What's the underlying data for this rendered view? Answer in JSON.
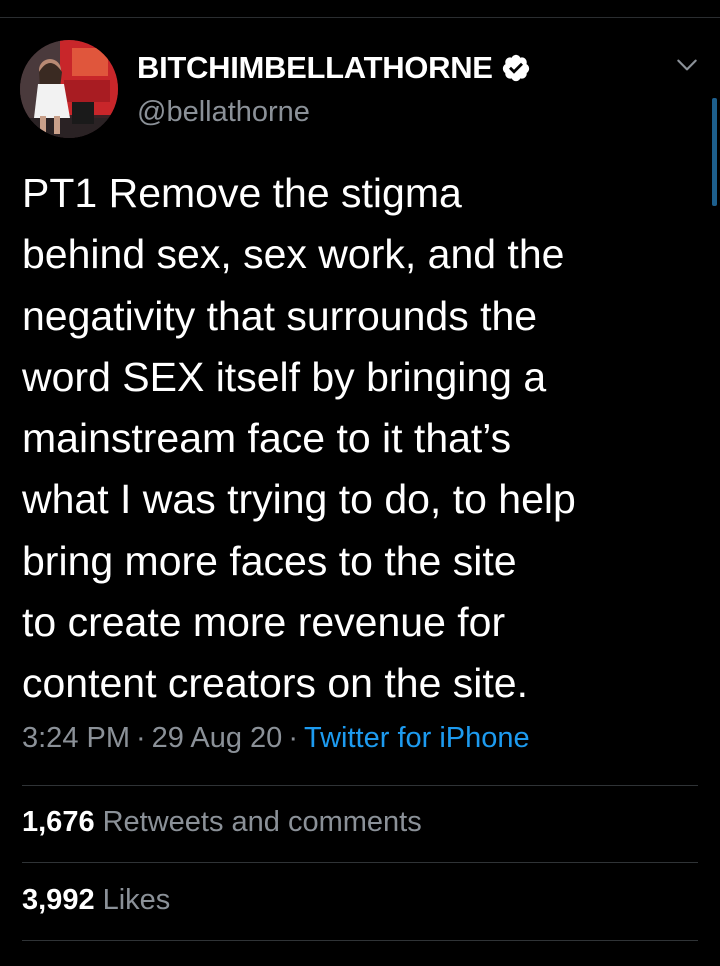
{
  "user": {
    "display_name": "BITCHIMBELLATHORNE",
    "handle": "@bellathorne",
    "verified": true
  },
  "tweet": {
    "lines": [
      "PT1 Remove the stigma",
      "behind sex, sex work, and the",
      "negativity that surrounds the",
      "word SEX itself by bringing a",
      "mainstream face to it that’s",
      "what I was trying to do, to help",
      "bring more faces to the site",
      "to create more revenue for",
      "content creators on the site."
    ],
    "time": "3:24 PM",
    "separator": "·",
    "date": "29 Aug 20",
    "source": "Twitter for iPhone"
  },
  "stats": {
    "retweets_count": "1,676",
    "retweets_label": "Retweets and comments",
    "likes_count": "3,992",
    "likes_label": "Likes"
  },
  "colors": {
    "background": "#000000",
    "text": "#ffffff",
    "secondary_text": "#8b9198",
    "link": "#1d9bf0",
    "verified_badge": "#ffffff"
  },
  "icons": {
    "verified": "verified-badge-icon",
    "menu": "chevron-down-icon"
  }
}
